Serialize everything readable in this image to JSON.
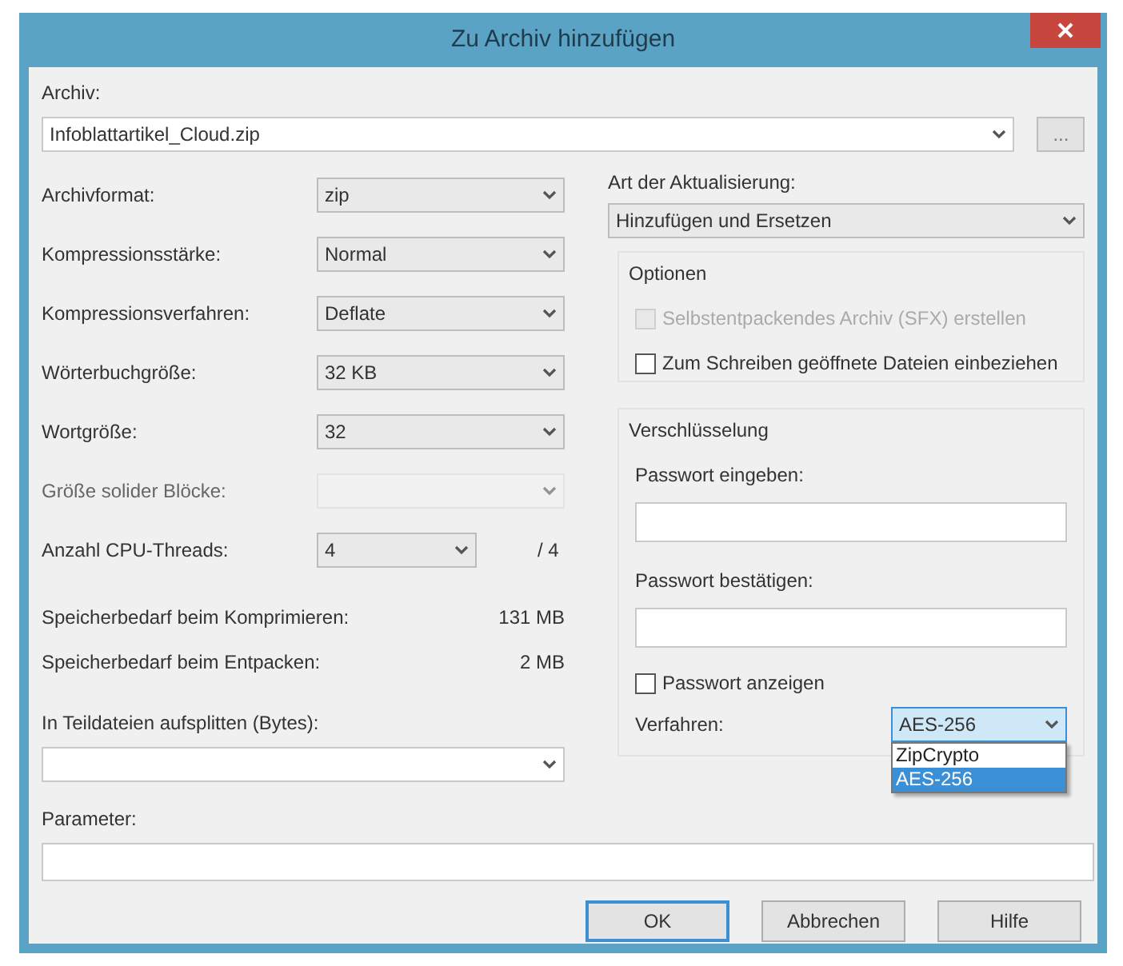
{
  "window": {
    "title": "Zu Archiv hinzufügen"
  },
  "archive": {
    "label": "Archiv:",
    "value": "Infoblattartikel_Cloud.zip",
    "browse": "..."
  },
  "settings": [
    {
      "label": "Archivformat:",
      "value": "zip",
      "disabled": false
    },
    {
      "label": "Kompressionsstärke:",
      "value": "Normal",
      "disabled": false
    },
    {
      "label": "Kompressionsverfahren:",
      "value": "Deflate",
      "disabled": false
    },
    {
      "label": "Wörterbuchgröße:",
      "value": "32 KB",
      "disabled": false
    },
    {
      "label": "Wortgröße:",
      "value": "32",
      "disabled": false
    },
    {
      "label": "Größe solider Blöcke:",
      "disabled": true
    },
    {
      "label": "Anzahl CPU-Threads:",
      "value": "4",
      "disabled": false,
      "suffix": "/ 4"
    }
  ],
  "memory": [
    {
      "label": "Speicherbedarf beim Komprimieren:",
      "value": "131 MB"
    },
    {
      "label": "Speicherbedarf beim Entpacken:",
      "value": "2 MB"
    }
  ],
  "split": {
    "label": "In Teildateien aufsplitten (Bytes):"
  },
  "update": {
    "label": "Art der Aktualisierung:",
    "value": "Hinzufügen und Ersetzen"
  },
  "options": {
    "title": "Optionen",
    "items": [
      {
        "label": "Selbstentpackendes Archiv (SFX) erstellen",
        "checked": false,
        "disabled": true
      },
      {
        "label": "Zum Schreiben geöffnete Dateien einbeziehen",
        "checked": false,
        "disabled": false
      }
    ]
  },
  "encryption": {
    "title": "Verschlüsselung",
    "password_label": "Passwort eingeben:",
    "confirm_label": "Passwort bestätigen:",
    "show_password": {
      "label": "Passwort anzeigen",
      "checked": false
    },
    "method": {
      "label": "Verfahren:",
      "value": "AES-256",
      "expanded": true,
      "options": [
        {
          "label": "ZipCrypto",
          "selected": false
        },
        {
          "label": "AES-256",
          "selected": true
        }
      ]
    }
  },
  "parameter": {
    "label": "Parameter:"
  },
  "buttons": [
    {
      "label": "OK",
      "focused": true
    },
    {
      "label": "Abbrechen",
      "focused": false
    },
    {
      "label": "Hilfe",
      "focused": false
    }
  ]
}
